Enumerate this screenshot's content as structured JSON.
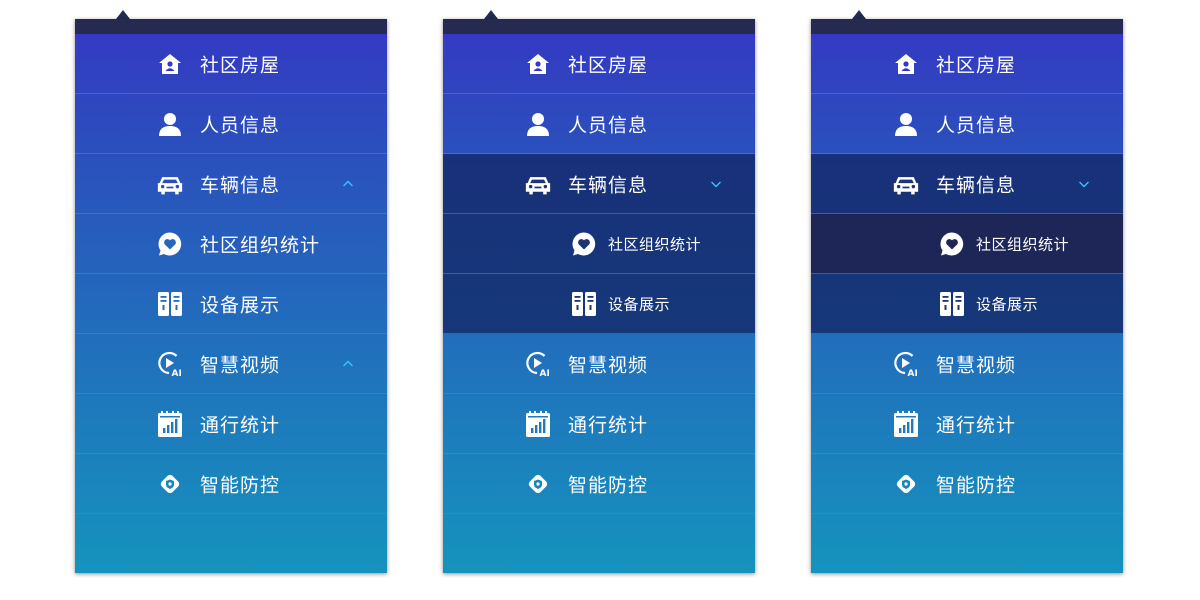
{
  "colors": {
    "header": "#262a50",
    "gradient_top": "#3537c4",
    "gradient_bottom": "#1593bd",
    "chevron": "#36c6ff",
    "selected_dark": "#1e2658"
  },
  "panels": [
    {
      "items": [
        {
          "label": "社区房屋",
          "icon": "house-icon"
        },
        {
          "label": "人员信息",
          "icon": "person-icon"
        },
        {
          "label": "车辆信息",
          "icon": "car-icon",
          "chevron": "up"
        },
        {
          "label": "社区组织统计",
          "icon": "heart-chat-icon"
        },
        {
          "label": "设备展示",
          "icon": "cabinet-icon"
        },
        {
          "label": "智慧视频",
          "icon": "ai-video-icon",
          "chevron": "up"
        },
        {
          "label": "通行统计",
          "icon": "calendar-chart-icon"
        },
        {
          "label": "智能防控",
          "icon": "shield-icon"
        }
      ]
    },
    {
      "items": [
        {
          "label": "社区房屋",
          "icon": "house-icon"
        },
        {
          "label": "人员信息",
          "icon": "person-icon"
        },
        {
          "label": "车辆信息",
          "icon": "car-icon",
          "chevron": "down"
        },
        {
          "label": "社区组织统计",
          "icon": "heart-chat-icon"
        },
        {
          "label": "设备展示",
          "icon": "cabinet-icon"
        },
        {
          "label": "智慧视频",
          "icon": "ai-video-icon"
        },
        {
          "label": "通行统计",
          "icon": "calendar-chart-icon"
        },
        {
          "label": "智能防控",
          "icon": "shield-icon"
        }
      ]
    },
    {
      "items": [
        {
          "label": "社区房屋",
          "icon": "house-icon"
        },
        {
          "label": "人员信息",
          "icon": "person-icon"
        },
        {
          "label": "车辆信息",
          "icon": "car-icon",
          "chevron": "down"
        },
        {
          "label": "社区组织统计",
          "icon": "heart-chat-icon"
        },
        {
          "label": "设备展示",
          "icon": "cabinet-icon"
        },
        {
          "label": "智慧视频",
          "icon": "ai-video-icon"
        },
        {
          "label": "通行统计",
          "icon": "calendar-chart-icon"
        },
        {
          "label": "智能防控",
          "icon": "shield-icon"
        }
      ]
    }
  ]
}
